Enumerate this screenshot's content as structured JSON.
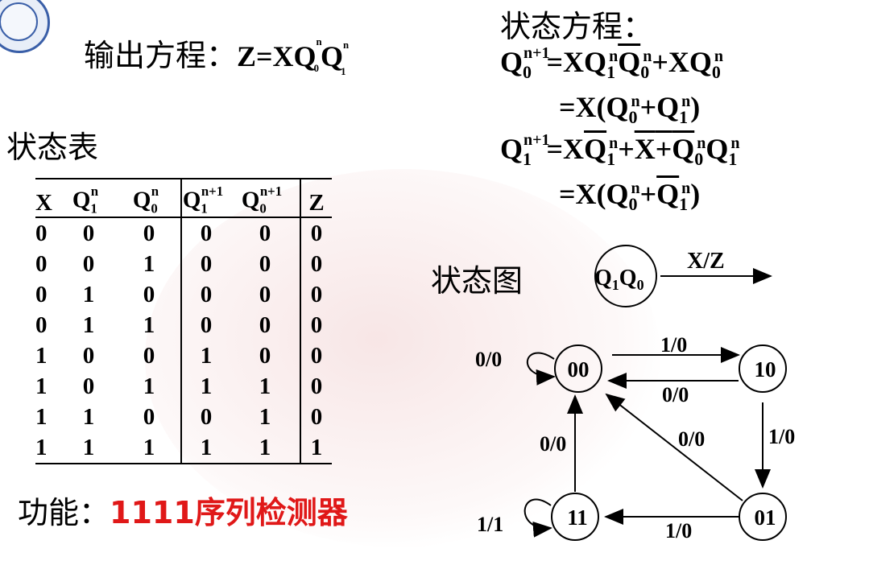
{
  "output_eq": {
    "label": "输出方程：",
    "z": "Z=XQ",
    "q0_sup": "n",
    "q0_sub": "0",
    "q1": "Q",
    "q1_sup": "n",
    "q1_sub": "1"
  },
  "state_eq": {
    "title": "状态方程：",
    "line1": "Q0n+1=XQ1nQ̄0n+XQ0n",
    "line2": "=X(Q0n+Q1n)",
    "line3": "Q1n+1=XQ̄1n+X̄+Q̄0nQ1n",
    "line4": "=X(Q0n+Q̄1n)"
  },
  "state_table": {
    "title": "状态表",
    "headers": [
      "X",
      "Q1n",
      "Q0n",
      "Q1n+1",
      "Q0n+1",
      "Z"
    ],
    "rows": [
      [
        "0",
        "0",
        "0",
        "0",
        "0",
        "0"
      ],
      [
        "0",
        "0",
        "1",
        "0",
        "0",
        "0"
      ],
      [
        "0",
        "1",
        "0",
        "0",
        "0",
        "0"
      ],
      [
        "0",
        "1",
        "1",
        "0",
        "0",
        "0"
      ],
      [
        "1",
        "0",
        "0",
        "1",
        "0",
        "0"
      ],
      [
        "1",
        "0",
        "1",
        "1",
        "1",
        "0"
      ],
      [
        "1",
        "1",
        "0",
        "0",
        "1",
        "0"
      ],
      [
        "1",
        "1",
        "1",
        "1",
        "1",
        "1"
      ]
    ]
  },
  "function": {
    "label": "功能：",
    "value": "1111序列检测器",
    "value_color": "#e01818"
  },
  "state_diagram": {
    "title": "状态图",
    "legend_node": "Q1Q0",
    "legend_arrow": "X/Z",
    "nodes": [
      "00",
      "10",
      "01",
      "11"
    ],
    "edges": [
      {
        "from": "00",
        "to": "00",
        "label": "0/0"
      },
      {
        "from": "00",
        "to": "10",
        "label": "1/0"
      },
      {
        "from": "10",
        "to": "00",
        "label": "0/0"
      },
      {
        "from": "10",
        "to": "01",
        "label": "1/0"
      },
      {
        "from": "01",
        "to": "00",
        "label": "0/0"
      },
      {
        "from": "01",
        "to": "11",
        "label": "1/0"
      },
      {
        "from": "11",
        "to": "00",
        "label": "0/0"
      },
      {
        "from": "11",
        "to": "11",
        "label": "1/1"
      }
    ]
  }
}
